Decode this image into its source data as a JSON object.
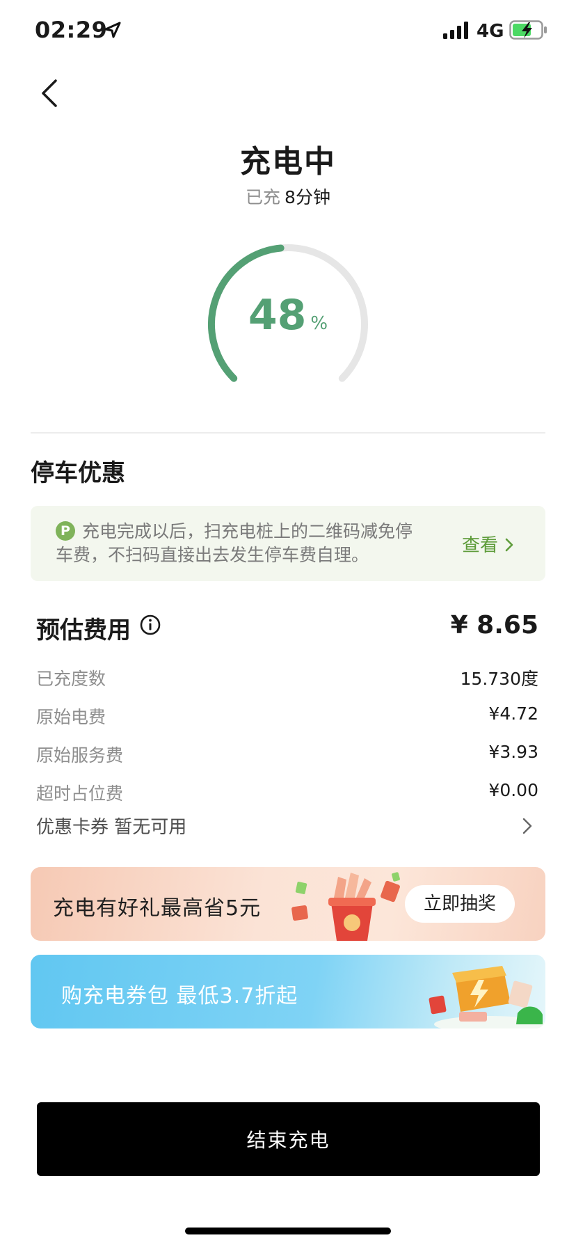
{
  "status_bar": {
    "time": "02:29",
    "network": "4G",
    "icons": [
      "location-arrow-icon",
      "signal-icon",
      "battery-charging-icon"
    ]
  },
  "header": {
    "back_icon": "chevron-left-icon",
    "title": "充电中",
    "elapsed_label": "已充",
    "elapsed_value": "8分钟"
  },
  "gauge": {
    "percent_text": "48",
    "unit": "%",
    "fraction": 0.48,
    "color": "#54a074",
    "track_color": "#e6e6e6"
  },
  "parking": {
    "section_title": "停车优惠",
    "icon_letter": "P",
    "text": "充电完成以后，扫充电桩上的二维码减免停车费，不扫码直接出去发生停车费自理。",
    "link_label": "查看",
    "accent": "#5e9c3a"
  },
  "fees": {
    "title": "预估费用",
    "total": "¥ 8.65",
    "rows": [
      {
        "label": "已充度数",
        "value": "15.730度"
      },
      {
        "label": "原始电费",
        "value": "¥4.72"
      },
      {
        "label": "原始服务费",
        "value": "¥3.93"
      },
      {
        "label": "超时占位费",
        "value": "¥0.00"
      }
    ],
    "coupon_label": "优惠卡券 暂无可用"
  },
  "banners": {
    "lottery_text": "充电有好礼最高省5元",
    "lottery_button": "立即抽奖",
    "coupon_text": "购充电券包 最低3.7折起"
  },
  "actions": {
    "end_label": "结束充电"
  }
}
